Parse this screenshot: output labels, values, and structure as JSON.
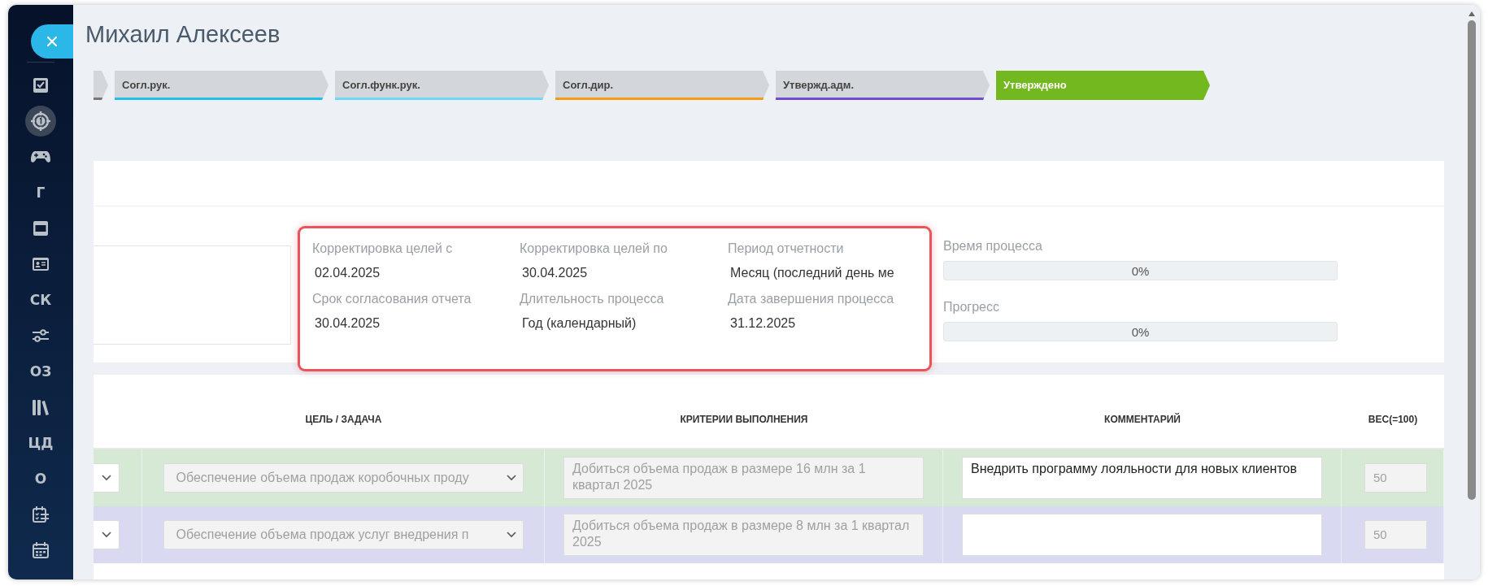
{
  "sidebar": {
    "items": [
      {
        "kind": "check",
        "selected": false
      },
      {
        "kind": "target",
        "selected": true
      },
      {
        "kind": "gamepad",
        "selected": false
      },
      {
        "kind": "text",
        "label": "Г",
        "selected": false
      },
      {
        "kind": "window",
        "selected": false
      },
      {
        "kind": "card",
        "selected": false
      },
      {
        "kind": "text",
        "label": "СК",
        "selected": false
      },
      {
        "kind": "sliders",
        "selected": false
      },
      {
        "kind": "text",
        "label": "ОЗ",
        "selected": false
      },
      {
        "kind": "books",
        "selected": false
      },
      {
        "kind": "text",
        "label": "ЦД",
        "selected": false
      },
      {
        "kind": "text",
        "label": "О",
        "selected": false
      },
      {
        "kind": "checklist",
        "selected": false
      },
      {
        "kind": "calendar",
        "selected": false
      }
    ]
  },
  "title": "Михаил Алексеев",
  "steps": [
    {
      "label": "Согл.рук.",
      "color": "#1ebfe8",
      "selected": false
    },
    {
      "label": "Согл.функ.рук.",
      "color": "#6fd8f7",
      "selected": false
    },
    {
      "label": "Согл.дир.",
      "color": "#f39c12",
      "selected": false
    },
    {
      "label": "Утвержд.адм.",
      "color": "#6f4ccf",
      "selected": false
    },
    {
      "label": "Утверждено",
      "color": "#74b81f",
      "selected": true
    }
  ],
  "info_fields": [
    {
      "label": "Корректировка целей с",
      "value": "02.04.2025"
    },
    {
      "label": "Корректировка целей по",
      "value": "30.04.2025"
    },
    {
      "label": "Период отчетности",
      "value": "Месяц (последний день ме"
    },
    {
      "label": "Срок согласования отчета",
      "value": "30.04.2025"
    },
    {
      "label": "Длительность процесса",
      "value": "Год (календарный)"
    },
    {
      "label": "Дата завершения процесса",
      "value": "31.12.2025"
    }
  ],
  "progress": [
    {
      "label": "Время процесса",
      "level": 0,
      "reading": "0%"
    },
    {
      "label": "Прогресс",
      "level": 0,
      "reading": "0%"
    }
  ],
  "table": {
    "columns": [
      "ЦЕЛЬ / ЗАДАЧА",
      "КРИТЕРИИ ВЫПОЛНЕНИЯ",
      "КОММЕНТАРИЙ",
      "ВЕС(=100)"
    ],
    "rows": [
      {
        "color": "#d6e9d5",
        "goal": {
          "value": "Обеспечение объема продаж коробочных проду",
          "disabled": true
        },
        "criteria": {
          "value": "Добиться объема продаж в размере 16 млн за 1 квартал 2025",
          "disabled": true
        },
        "comment": {
          "value": "Внедрить программу лояльности для новых клиентов",
          "disabled": false
        },
        "weight": {
          "value": "50",
          "disabled": true
        }
      },
      {
        "color": "#d9d9f2",
        "goal": {
          "value": "Обеспечение объема продаж услуг внедрения п",
          "disabled": true
        },
        "criteria": {
          "value": "Добиться объема продаж в размере 8 млн за 1 квартал 2025",
          "disabled": true
        },
        "comment": {
          "disabled": false
        },
        "weight": {
          "value": "50",
          "disabled": true
        }
      }
    ]
  }
}
